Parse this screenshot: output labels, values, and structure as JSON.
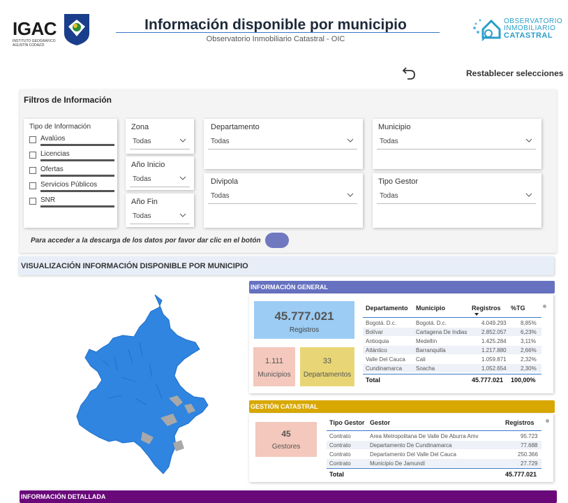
{
  "header": {
    "igac_logo": "IGAC",
    "igac_sub": "INSTITUTO GEOGRÁFICO AGUSTÍN CODAZZI",
    "title": "Información disponible por municipio",
    "subtitle": "Observatorio Inmobiliario Catastral - OIC",
    "obs_logo": [
      "OBSERVATORIO",
      "INMOBILIARIO",
      "CATASTRAL"
    ],
    "reset_label": "Restablecer selecciones",
    "reset_icon": "undo-icon",
    "brand_color": "#3b78c8"
  },
  "filters": {
    "title": "Filtros de Información",
    "tipo_label": "Tipo de Información",
    "tipo_options": [
      "Avalúos",
      "Licencias",
      "Ofertas",
      "Servicios Públicos",
      "SNR"
    ],
    "zona": {
      "label": "Zona",
      "value": "Todas"
    },
    "anio_inicio": {
      "label": "Año Inicio",
      "value": "Todas"
    },
    "anio_fin": {
      "label": "Año Fin",
      "value": "Todas"
    },
    "departamento": {
      "label": "Departamento",
      "value": "Todas"
    },
    "municipio": {
      "label": "Municipio",
      "value": "Todas"
    },
    "divipola": {
      "label": "Divipola",
      "value": "Todas"
    },
    "tipo_gestor": {
      "label": "Tipo Gestor",
      "value": "Todas"
    },
    "notice": "Para acceder a la descarga de los datos por favor dar clic en el botón"
  },
  "viz_banner": "VISUALIZACIÓN INFORMACIÓN DISPONIBLE POR MUNICIPIO",
  "info_general": {
    "header": "INFORMACIÓN GENERAL",
    "header_color": "#6671c0",
    "registros_value": "45.777.021",
    "registros_label": "Registros",
    "municipios_value": "1.111",
    "municipios_label": "Municipios",
    "departamentos_value": "33",
    "departamentos_label": "Departamentos",
    "columns": [
      "Departamento",
      "Municipio",
      "Registros",
      "%TG"
    ],
    "rows": [
      [
        "Bogotá. D.c.",
        "Bogotá. D.c.",
        "4.049.293",
        "8,85%"
      ],
      [
        "Bolívar",
        "Cartagena De Indias",
        "2.852.057",
        "6,23%"
      ],
      [
        "Antioquia",
        "Medellín",
        "1.425.284",
        "3,11%"
      ],
      [
        "Atlántico",
        "Barranquilla",
        "1.217.880",
        "2,66%"
      ],
      [
        "Valle Del Cauca",
        "Cali",
        "1.059.871",
        "2,32%"
      ],
      [
        "Cundinamarca",
        "Soacha",
        "1.052.654",
        "2,30%"
      ]
    ],
    "total_label": "Total",
    "total_registros": "45.777.021",
    "total_pct": "100,00%"
  },
  "gestion": {
    "header": "GESTIÓN CATASTRAL",
    "header_color": "#d8a800",
    "gestores_value": "45",
    "gestores_label": "Gestores",
    "columns": [
      "Tipo Gestor",
      "Gestor",
      "Registros"
    ],
    "rows": [
      [
        "Contrato",
        "Area Metropolitana De Valle De Aburra Amv",
        "95.723"
      ],
      [
        "Contrato",
        "Departamento De Cundinamarca",
        "77.688"
      ],
      [
        "Contrato",
        "Departamento Del Valle Del Cauca",
        "250.366"
      ],
      [
        "Contrato",
        "Municipio De Jamundí",
        "27.729"
      ]
    ],
    "total_label": "Total",
    "total_registros": "45.777.021"
  },
  "detallada": {
    "header": "INFORMACIÓN DETALLADA",
    "header_color": "#6a0a7a"
  }
}
